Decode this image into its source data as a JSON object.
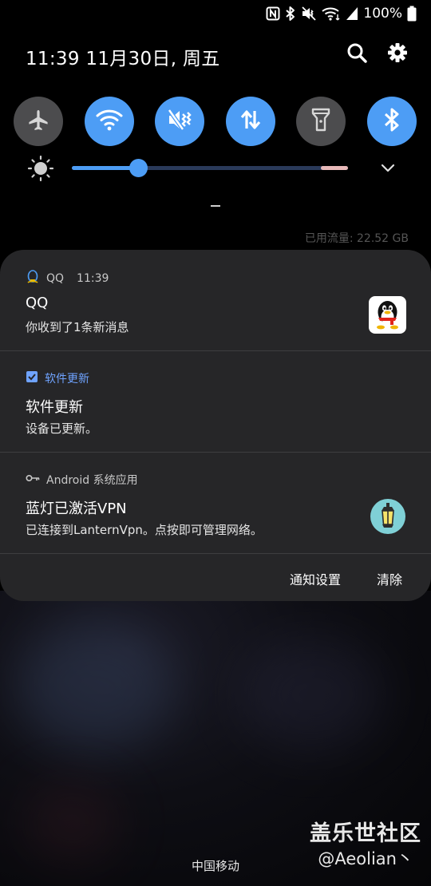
{
  "status_bar": {
    "battery_percent": "100%"
  },
  "header": {
    "date_time": "11:39  11月30日, 周五"
  },
  "quick_settings": {
    "toggles": [
      {
        "name": "airplane",
        "on": false
      },
      {
        "name": "wifi",
        "on": true
      },
      {
        "name": "sound-off",
        "on": true
      },
      {
        "name": "mobile-data",
        "on": true
      },
      {
        "name": "flashlight",
        "on": false
      },
      {
        "name": "bluetooth",
        "on": true
      }
    ],
    "brightness_level": 0.24,
    "data_usage": "已用流量: 22.52 GB"
  },
  "notifications": [
    {
      "app": "QQ",
      "time": "11:39",
      "title": "QQ",
      "text": "你收到了1条新消息",
      "icon": "qq-penguin-icon"
    },
    {
      "app": "软件更新",
      "title": "软件更新",
      "text": "设备已更新。",
      "icon": "checkbox-icon"
    },
    {
      "app": "Android 系统应用",
      "title": "蓝灯已激活VPN",
      "text": "已连接到LanternVpn。点按即可管理网络。",
      "icon": "lantern-icon"
    }
  ],
  "actions": {
    "settings_label": "通知设置",
    "clear_label": "清除"
  },
  "carrier": "中国移动",
  "watermark": {
    "site": "盖乐世社区",
    "user": "@Aeolian丶"
  },
  "colors": {
    "accent": "#4d9df5",
    "panel": "#262628",
    "toggle_off": "#4c4c4e"
  }
}
